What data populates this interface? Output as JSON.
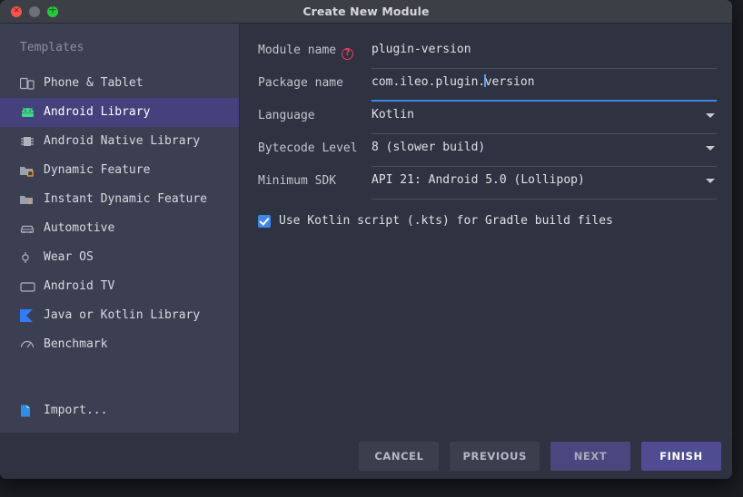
{
  "window": {
    "title": "Create New Module",
    "controls": [
      {
        "name": "close",
        "glyph": "✕"
      },
      {
        "name": "minimize",
        "glyph": ""
      },
      {
        "name": "maximize",
        "glyph": "＋"
      }
    ]
  },
  "sidebar": {
    "heading": "Templates",
    "items": [
      {
        "label": "Phone & Tablet",
        "icon": "phone-tablet-icon",
        "selected": false
      },
      {
        "label": "Android Library",
        "icon": "android-robot-icon",
        "selected": true
      },
      {
        "label": "Android Native Library",
        "icon": "chip-icon",
        "selected": false
      },
      {
        "label": "Dynamic Feature",
        "icon": "folder-module-icon",
        "selected": false
      },
      {
        "label": "Instant Dynamic Feature",
        "icon": "folder-instant-icon",
        "selected": false
      },
      {
        "label": "Automotive",
        "icon": "car-icon",
        "selected": false
      },
      {
        "label": "Wear OS",
        "icon": "watch-icon",
        "selected": false
      },
      {
        "label": "Android TV",
        "icon": "tv-icon",
        "selected": false
      },
      {
        "label": "Java or Kotlin Library",
        "icon": "kotlin-k-icon",
        "selected": false
      },
      {
        "label": "Benchmark",
        "icon": "benchmark-gauge-icon",
        "selected": false
      }
    ],
    "import": {
      "label": "Import...",
      "icon": "import-file-icon"
    }
  },
  "form": {
    "fields": [
      {
        "label": "Module name",
        "value": "plugin-version",
        "type": "text",
        "error_icon": "?",
        "has_error_icon": true,
        "focused": false
      },
      {
        "label": "Package name",
        "value_before_caret": "com.ileo.plugin.",
        "value_after_caret": "version",
        "value": "com.ileo.plugin.version",
        "type": "text",
        "has_error_icon": false,
        "focused": true
      },
      {
        "label": "Language",
        "value": "Kotlin",
        "type": "dropdown",
        "has_error_icon": false,
        "focused": false
      },
      {
        "label": "Bytecode Level",
        "value": "8 (slower build)",
        "type": "dropdown",
        "has_error_icon": false,
        "focused": false
      },
      {
        "label": "Minimum SDK",
        "value": "API 21: Android 5.0 (Lollipop)",
        "type": "dropdown",
        "has_error_icon": false,
        "focused": false
      }
    ],
    "checkbox": {
      "label": "Use Kotlin script (.kts) for Gradle build files",
      "checked": true
    }
  },
  "footer": {
    "buttons": [
      {
        "label": "CANCEL",
        "style": "default"
      },
      {
        "label": "PREVIOUS",
        "style": "default"
      },
      {
        "label": "NEXT",
        "style": "accent"
      },
      {
        "label": "FINISH",
        "style": "primary"
      }
    ]
  },
  "colors": {
    "accent_blue": "#3d87e8",
    "selection_purple": "#44417d",
    "primary_button": "#4f4c91",
    "error_red": "#e8415c",
    "android_green": "#3ddc84",
    "kotlin_blue": "#2f7cf6",
    "sidebar_bg": "#3c3f51",
    "panel_bg": "#2f3240",
    "titlebar_bg": "#3c3f45"
  }
}
